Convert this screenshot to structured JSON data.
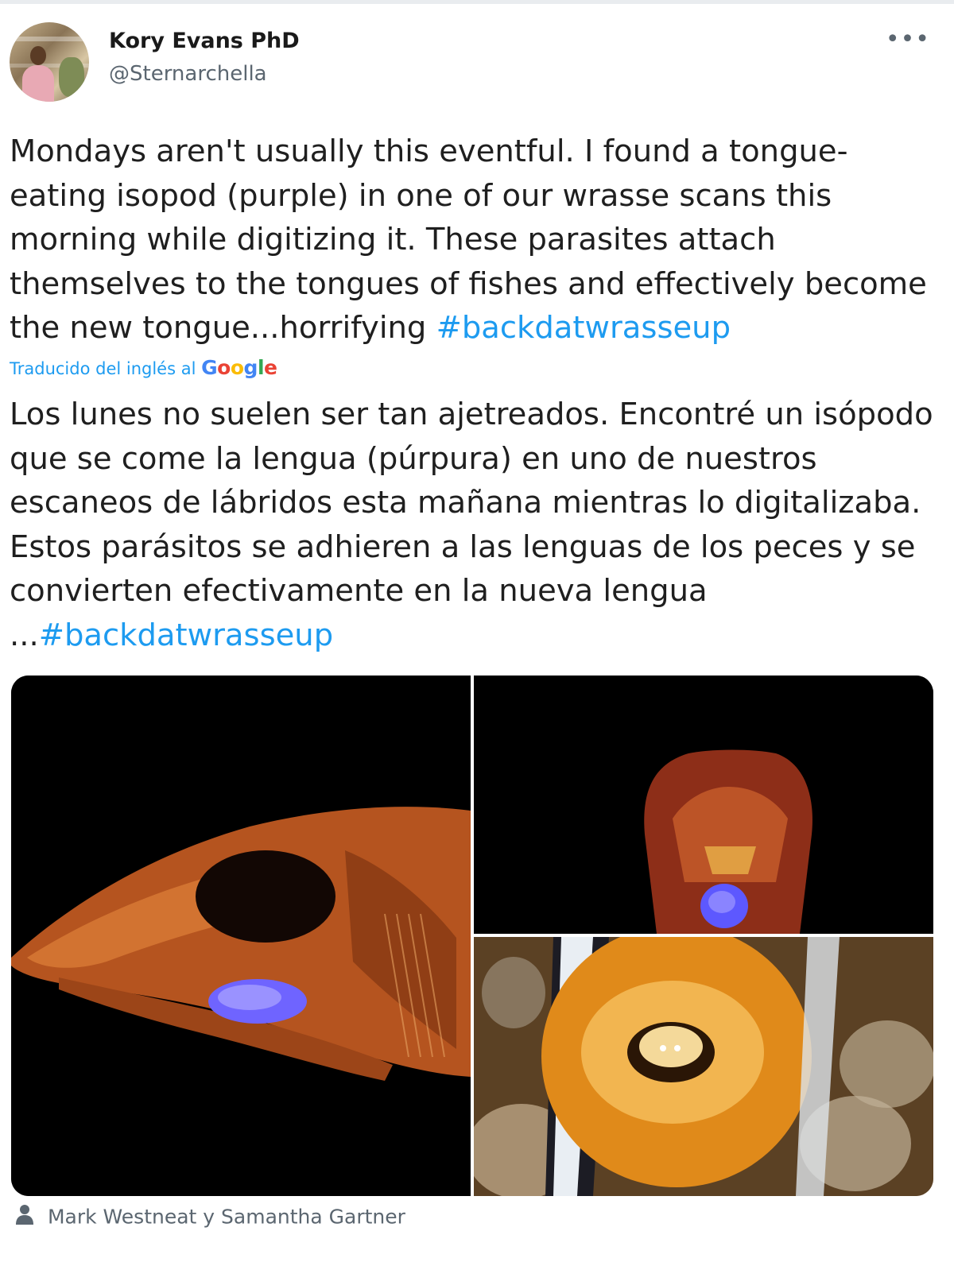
{
  "author": {
    "name": "Kory Evans PhD",
    "handle": "@Sternarchella",
    "more_label": "•••"
  },
  "tweet": {
    "text": "Mondays aren't usually this eventful. I found a tongue-eating isopod (purple) in one of our wrasse scans this morning while digitizing it. These parasites attach themselves to the tongues of fishes and effectively become the new tongue...horrifying ",
    "hashtag": "#backdatwrasseup"
  },
  "translation": {
    "label": "Traducido del inglés al",
    "provider_letters": [
      "G",
      "o",
      "o",
      "g",
      "l",
      "e"
    ],
    "text": "Los lunes no suelen ser tan ajetreados. Encontré un isópodo que se come la lengua (púrpura) en uno de nuestros escaneos de lábridos esta mañana mientras lo digitalizaba. Estos parásitos se adhieren a las lenguas de los peces y se convierten efectivamente en la nueva lengua ...",
    "hashtag": "#backdatwrasseup"
  },
  "media": {
    "credit": "Mark Westneat y Samantha Gartner"
  },
  "colors": {
    "hashtag": "#1d9bf0",
    "secondary_text": "#5b6670"
  }
}
